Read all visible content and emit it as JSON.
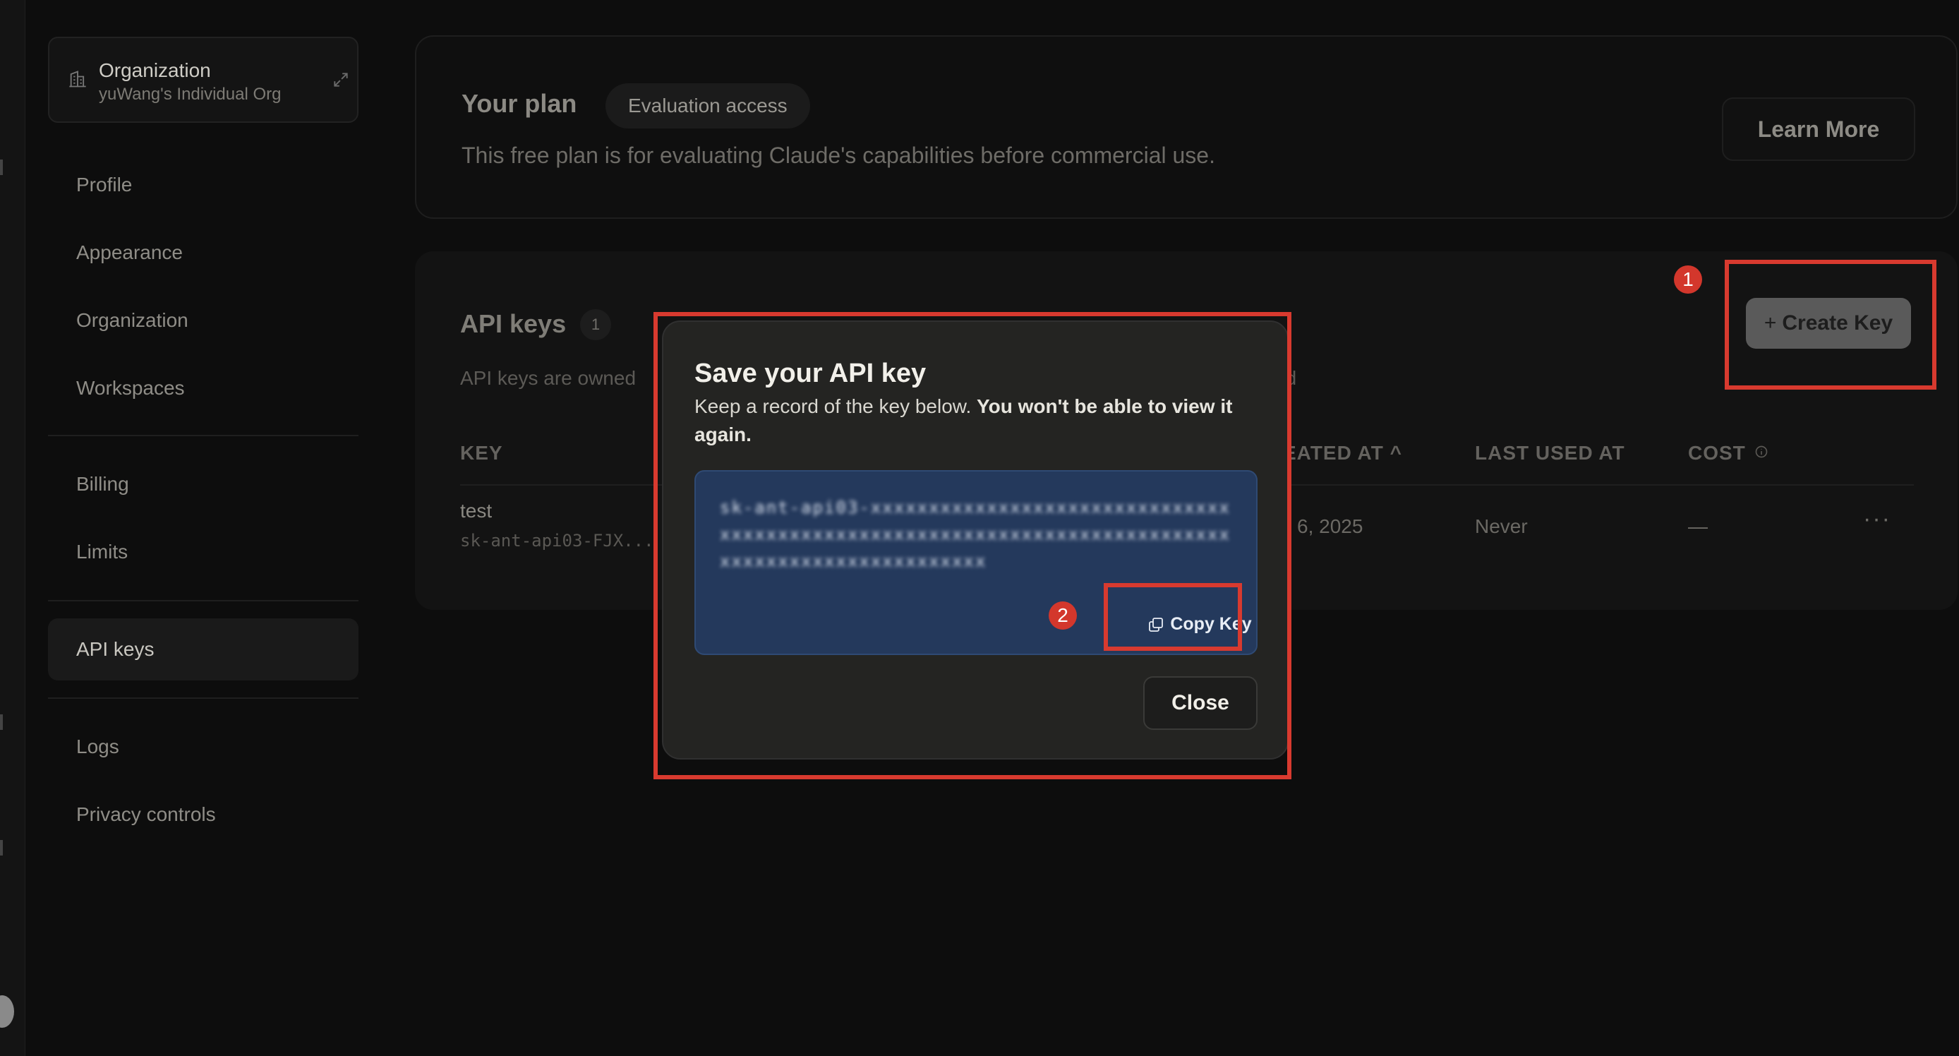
{
  "sidebar": {
    "org_title": "Organization",
    "org_subtitle": "yuWang's Individual Org",
    "items": [
      {
        "label": "Profile"
      },
      {
        "label": "Appearance"
      },
      {
        "label": "Organization"
      },
      {
        "label": "Workspaces"
      },
      {
        "label": "Billing"
      },
      {
        "label": "Limits"
      },
      {
        "label": "API keys",
        "active": true
      },
      {
        "label": "Logs"
      },
      {
        "label": "Privacy controls"
      }
    ]
  },
  "plan": {
    "title": "Your plan",
    "badge": "Evaluation access",
    "description": "This free plan is for evaluating Claude's capabilities before commercial use.",
    "learn_more": "Learn More"
  },
  "api_keys": {
    "title": "API keys",
    "count": "1",
    "description_start": "API keys are owned",
    "description_end": "ed",
    "create_label": "Create Key",
    "columns": {
      "key": "KEY",
      "created_at": "EATED AT ^",
      "last_used": "LAST USED AT",
      "cost": "COST"
    },
    "rows": [
      {
        "name": "test",
        "key_prefix": "sk-ant-api03-FJX...",
        "created": "6, 2025",
        "last_used": "Never",
        "cost": "—",
        "more": "···"
      }
    ]
  },
  "modal": {
    "title": "Save your API key",
    "desc_plain": "Keep a record of the key below. ",
    "desc_bold": "You won't be able to view it again.",
    "key_obscured": "sk-ant-api03-xxxxxxxxxxxxxxxxxxxxxxxxxxxxxxxxxxxxxxxxxxxxxxxxxxxxxxxxxxxxxxxxxxxxxxxxxxxxxxxxxxxxxxxxxxxxxxxxxx",
    "copy_label": "Copy Key",
    "close_label": "Close"
  },
  "annotations": {
    "step1": "1",
    "step2": "2",
    "color": "#d83a2f"
  },
  "colors": {
    "background": "#0d0d0d",
    "modal_bg": "#242422",
    "key_box_bg": "#24395c",
    "annotation": "#d83a2f"
  }
}
